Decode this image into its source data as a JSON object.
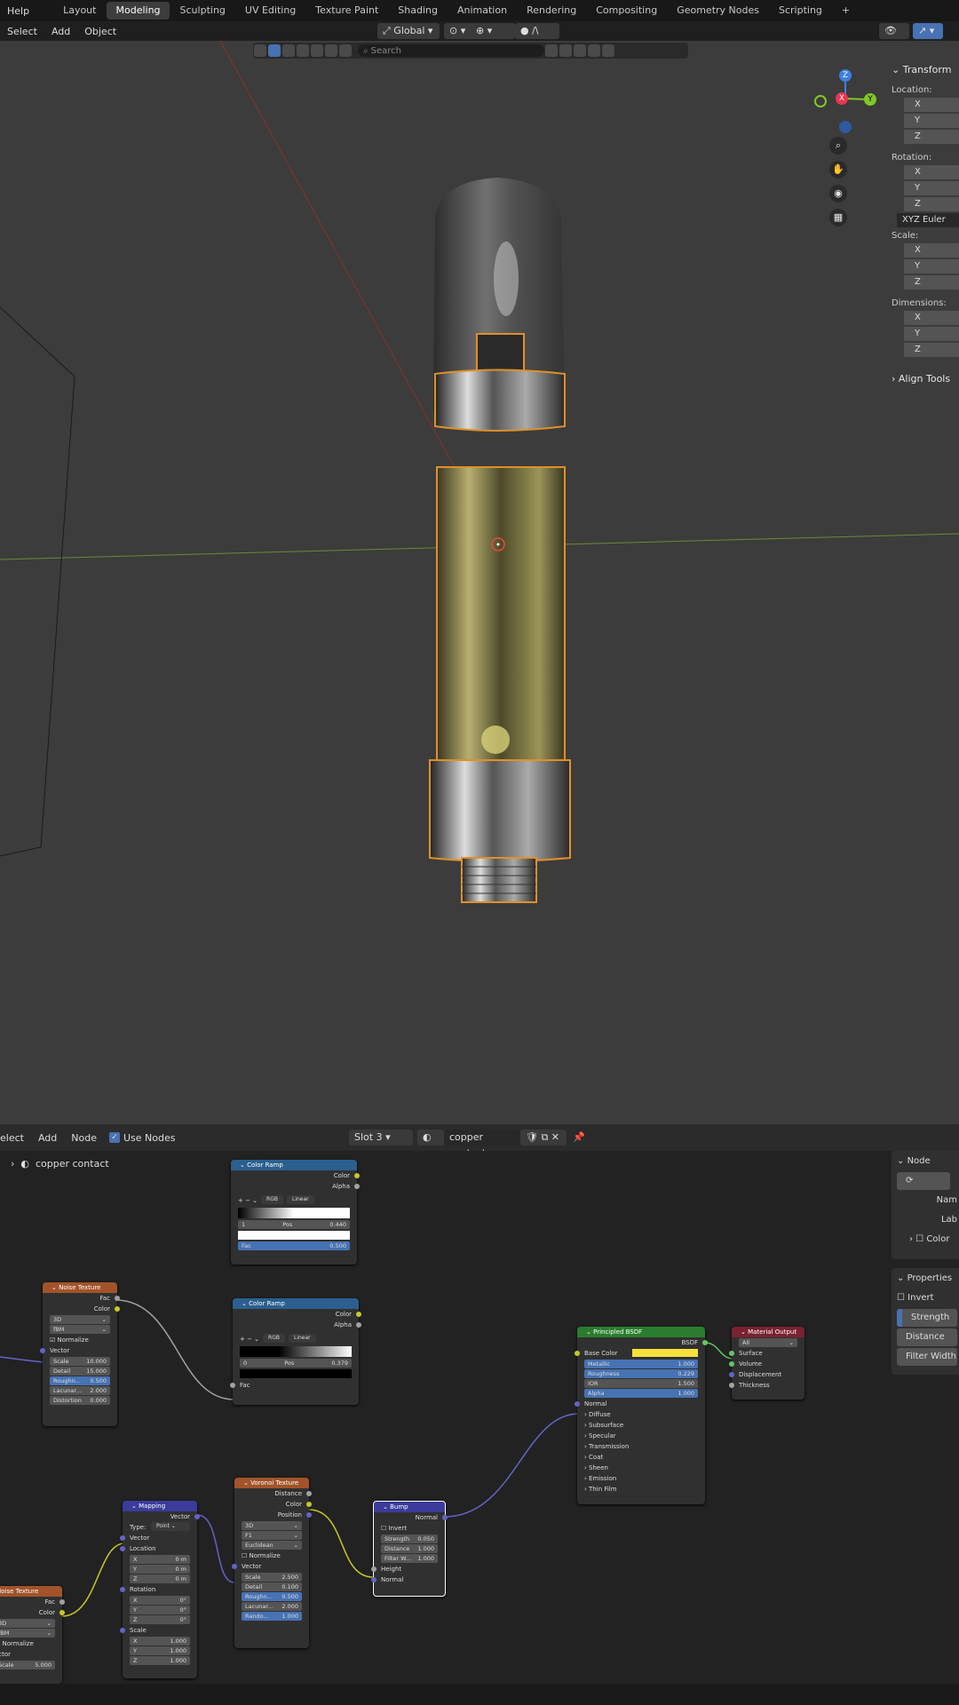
{
  "topbar": {
    "help": "Help",
    "workspaces": [
      "Layout",
      "Modeling",
      "Sculpting",
      "UV Editing",
      "Texture Paint",
      "Shading",
      "Animation",
      "Rendering",
      "Compositing",
      "Geometry Nodes",
      "Scripting"
    ],
    "active": "Modeling",
    "plus": "+"
  },
  "viewport_header": {
    "select": "Select",
    "add": "Add",
    "object": "Object",
    "orientation": "Global"
  },
  "viewport": {
    "search_placeholder": "Search",
    "gizmo": {
      "x": "X",
      "y": "Y",
      "z": "Z"
    },
    "colors": {
      "x": "#e8364f",
      "y": "#80c826",
      "z": "#3d7fe3",
      "selection": "#e08f2a"
    }
  },
  "npanel": {
    "title": "Transform",
    "location": "Location:",
    "rotation": "Rotation:",
    "euler": "XYZ Euler",
    "scale": "Scale:",
    "dimensions": "Dimensions:",
    "axes": [
      "X",
      "Y",
      "Z"
    ],
    "align": "Align Tools"
  },
  "node_header": {
    "select": "elect",
    "add": "Add",
    "node": "Node",
    "use_nodes": "Use Nodes",
    "slot": "Slot 3",
    "material": "copper contact",
    "breadcrumb": "copper contact"
  },
  "side_node": {
    "title": "Node",
    "name": "Nam",
    "label": "Lab",
    "color": "Color"
  },
  "side_props": {
    "title": "Properties",
    "invert": "Invert",
    "strength": "Strength",
    "distance": "Distance",
    "filter_width": "Filter Width"
  },
  "nodes": {
    "color_ramp_1": {
      "title": "Color Ramp",
      "out": [
        "Color",
        "Alpha"
      ],
      "mode": "RGB",
      "interp": "Linear",
      "index": "1",
      "pos_label": "Pos",
      "pos": "0.440",
      "fac_label": "Fac",
      "fac": "0.500"
    },
    "color_ramp_2": {
      "title": "Color Ramp",
      "out": [
        "Color",
        "Alpha"
      ],
      "mode": "RGB",
      "interp": "Linear",
      "index": "0",
      "pos_label": "Pos",
      "pos": "0.379",
      "fac_label": "Fac"
    },
    "noise_1": {
      "title": "Noise Texture",
      "out": [
        "Fac",
        "Color"
      ],
      "dim": "3D",
      "type": "fBM",
      "normalize": "Normalize",
      "vector": "Vector",
      "fields": [
        [
          "Scale",
          "10.000"
        ],
        [
          "Detail",
          "15.000"
        ],
        [
          "Roughn...",
          "0.500"
        ],
        [
          "Lacunar...",
          "2.000"
        ],
        [
          "Distortion",
          "0.000"
        ]
      ]
    },
    "principled": {
      "title": "Principled BSDF",
      "out": "BSDF",
      "base_color": "Base Color",
      "fields": [
        [
          "Metallic",
          "1.000"
        ],
        [
          "Roughness",
          "0.229"
        ],
        [
          "IOR",
          "1.500"
        ],
        [
          "Alpha",
          "1.000"
        ]
      ],
      "normal": "Normal",
      "panels": [
        "Diffuse",
        "Subsurface",
        "Specular",
        "Transmission",
        "Coat",
        "Sheen",
        "Emission",
        "Thin Film"
      ],
      "base_color_value": "#f4e23a"
    },
    "material_output": {
      "title": "Material Output",
      "target": "All",
      "inputs": [
        "Surface",
        "Volume",
        "Displacement",
        "Thickness"
      ]
    },
    "mapping": {
      "title": "Mapping",
      "out": "Vector",
      "type_label": "Type:",
      "type": "Point",
      "vector": "Vector",
      "location": "Location",
      "rotation": "Rotation",
      "scale": "Scale",
      "loc": [
        [
          "X",
          "0 m"
        ],
        [
          "Y",
          "0 m"
        ],
        [
          "Z",
          "0 m"
        ]
      ],
      "rot": [
        [
          "X",
          "0°"
        ],
        [
          "Y",
          "0°"
        ],
        [
          "Z",
          "0°"
        ]
      ],
      "scl": [
        [
          "X",
          "1.000"
        ],
        [
          "Y",
          "1.000"
        ],
        [
          "Z",
          "1.000"
        ]
      ]
    },
    "voronoi": {
      "title": "Voronoi Texture",
      "out": [
        "Distance",
        "Color",
        "Position"
      ],
      "dim": "3D",
      "feature": "F1",
      "metric": "Euclidean",
      "normalize": "Normalize",
      "vector": "Vector",
      "fields": [
        [
          "Scale",
          "2.500"
        ],
        [
          "Detail",
          "0.100"
        ],
        [
          "Roughn...",
          "0.500"
        ],
        [
          "Lacunar...",
          "2.000"
        ],
        [
          "Rando...",
          "1.000"
        ]
      ]
    },
    "bump": {
      "title": "Bump",
      "out": "Normal",
      "invert": "Invert",
      "fields": [
        [
          "Strength",
          "0.050"
        ],
        [
          "Distance",
          "1.000"
        ],
        [
          "Filter W...",
          "1.000"
        ]
      ],
      "height": "Height",
      "normal": "Normal"
    },
    "noise_2": {
      "title": "Noise Texture",
      "out": [
        "Fac",
        "Color"
      ],
      "dim": "3D",
      "type": "fBM",
      "normalize": "Normalize",
      "vector": "ector",
      "scale_label": "Scale",
      "scale": "5.000"
    }
  }
}
